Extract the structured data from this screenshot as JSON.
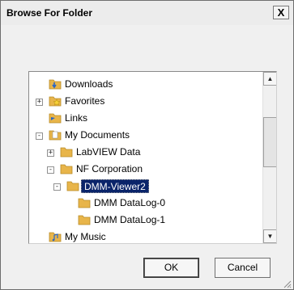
{
  "dialog": {
    "title": "Browse For Folder",
    "close_label": "X",
    "ok_label": "OK",
    "cancel_label": "Cancel"
  },
  "tree": {
    "items": [
      {
        "label": "Downloads",
        "expander": "",
        "icon": "downloads-folder-icon"
      },
      {
        "label": "Favorites",
        "expander": "+",
        "icon": "favorites-folder-icon"
      },
      {
        "label": "Links",
        "expander": "",
        "icon": "links-folder-icon"
      },
      {
        "label": "My Documents",
        "expander": "-",
        "icon": "documents-folder-icon"
      },
      {
        "label": "LabVIEW Data",
        "expander": "+",
        "icon": "folder-icon"
      },
      {
        "label": "NF Corporation",
        "expander": "-",
        "icon": "folder-icon"
      },
      {
        "label": "DMM-Viewer2",
        "expander": "-",
        "icon": "folder-icon",
        "selected": true
      },
      {
        "label": "DMM DataLog-0",
        "expander": "",
        "icon": "folder-icon"
      },
      {
        "label": "DMM DataLog-1",
        "expander": "",
        "icon": "folder-icon"
      },
      {
        "label": "My Music",
        "expander": "",
        "icon": "music-folder-icon"
      }
    ]
  },
  "colors": {
    "folder": "#e8b54a",
    "selection": "#0a246a"
  }
}
